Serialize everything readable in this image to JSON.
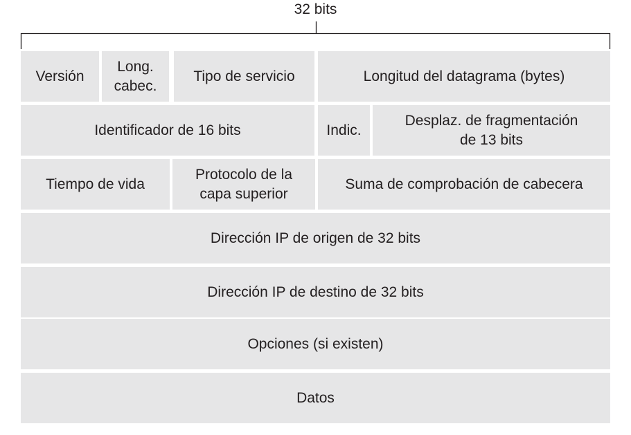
{
  "header": {
    "width_label": "32 bits"
  },
  "rows": [
    {
      "cells": [
        {
          "name": "version-field",
          "label": "Versión"
        },
        {
          "name": "header-length-field",
          "label": "Long.\ncabec."
        },
        {
          "name": "type-of-service-field",
          "label": "Tipo de servicio"
        },
        {
          "name": "datagram-length-field",
          "label": "Longitud del datagrama (bytes)"
        }
      ]
    },
    {
      "cells": [
        {
          "name": "identifier-field",
          "label": "Identificador de 16 bits"
        },
        {
          "name": "flags-field",
          "label": "Indic."
        },
        {
          "name": "fragment-offset-field",
          "label": "Desplaz. de fragmentación\nde 13 bits"
        }
      ]
    },
    {
      "cells": [
        {
          "name": "time-to-live-field",
          "label": "Tiempo de vida"
        },
        {
          "name": "upper-layer-protocol-field",
          "label": "Protocolo de la\ncapa superior"
        },
        {
          "name": "header-checksum-field",
          "label": "Suma de comprobación de cabecera"
        }
      ]
    },
    {
      "cells": [
        {
          "name": "source-ip-field",
          "label": "Dirección IP de origen de 32 bits"
        }
      ]
    },
    {
      "cells": [
        {
          "name": "destination-ip-field",
          "label": "Dirección IP de destino de 32 bits"
        }
      ]
    },
    {
      "cells": [
        {
          "name": "options-field",
          "label": "Opciones (si existen)"
        }
      ]
    },
    {
      "cells": [
        {
          "name": "data-field",
          "label": "Datos"
        }
      ]
    }
  ]
}
